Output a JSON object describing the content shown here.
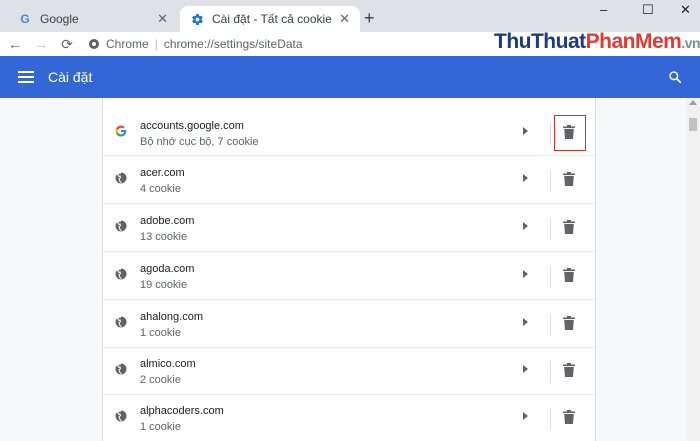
{
  "tabs": [
    {
      "title": "Google",
      "favicon": "google-g-icon",
      "active": false
    },
    {
      "title": "Cài đặt - Tất cả cookie và dữ liệu",
      "favicon": "gear-icon",
      "active": true
    }
  ],
  "window": {
    "minimize": "–",
    "maximize": "☐",
    "close": "✕"
  },
  "toolbar": {
    "site_chip": "Chrome",
    "separator": "|",
    "url": "chrome://settings/siteData"
  },
  "watermark": {
    "part1": "ThuThuat",
    "part2": "PhanMem",
    "part3": ".vn"
  },
  "header": {
    "title": "Cài đặt"
  },
  "colors": {
    "header_bg": "#3367d6",
    "highlight": "#d93025"
  },
  "sites": [
    {
      "name": "accounts.google.com",
      "detail": "Bộ nhớ cục bộ, 7 cookie",
      "icon": "google-g-icon"
    },
    {
      "name": "acer.com",
      "detail": "4 cookie",
      "icon": "globe-icon"
    },
    {
      "name": "adobe.com",
      "detail": "13 cookie",
      "icon": "globe-icon"
    },
    {
      "name": "agoda.com",
      "detail": "19 cookie",
      "icon": "globe-icon"
    },
    {
      "name": "ahalong.com",
      "detail": "1 cookie",
      "icon": "globe-icon"
    },
    {
      "name": "almico.com",
      "detail": "2 cookie",
      "icon": "globe-icon"
    },
    {
      "name": "alphacoders.com",
      "detail": "1 cookie",
      "icon": "globe-icon"
    }
  ]
}
